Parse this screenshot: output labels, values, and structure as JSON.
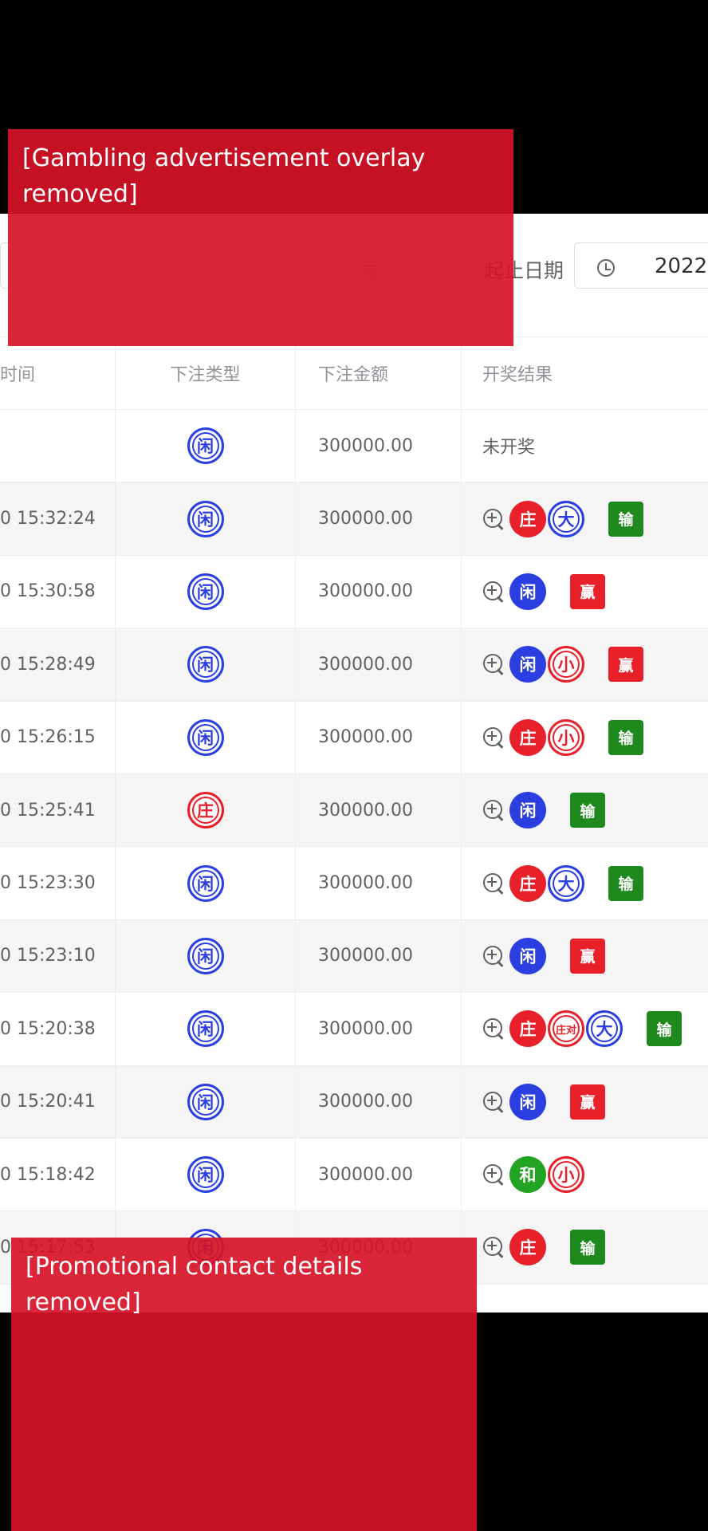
{
  "filter": {
    "search_placeholder": "号",
    "date_label": "起止日期",
    "date_value": "2022-"
  },
  "table": {
    "headers": {
      "time": "时间",
      "type": "下注类型",
      "amount": "下注金额",
      "result": "开奖结果"
    },
    "rows": [
      {
        "time": "",
        "type": "闲",
        "type_color": "blue",
        "amount": "300000.00",
        "result_text": "未开奖",
        "chips": [],
        "outcome": null
      },
      {
        "time": "0 15:32:24",
        "type": "闲",
        "type_color": "blue",
        "amount": "300000.00",
        "chips": [
          {
            "label": "庄",
            "style": "solid-red"
          },
          {
            "label": "大",
            "style": "outline-blue"
          }
        ],
        "outcome": {
          "label": "输",
          "kind": "lose"
        }
      },
      {
        "time": "0 15:30:58",
        "type": "闲",
        "type_color": "blue",
        "amount": "300000.00",
        "chips": [
          {
            "label": "闲",
            "style": "solid-blue"
          }
        ],
        "outcome": {
          "label": "赢",
          "kind": "win"
        }
      },
      {
        "time": "0 15:28:49",
        "type": "闲",
        "type_color": "blue",
        "amount": "300000.00",
        "chips": [
          {
            "label": "闲",
            "style": "solid-blue"
          },
          {
            "label": "小",
            "style": "outline-red"
          }
        ],
        "outcome": {
          "label": "赢",
          "kind": "win"
        }
      },
      {
        "time": "0 15:26:15",
        "type": "闲",
        "type_color": "blue",
        "amount": "300000.00",
        "chips": [
          {
            "label": "庄",
            "style": "solid-red"
          },
          {
            "label": "小",
            "style": "outline-red"
          }
        ],
        "outcome": {
          "label": "输",
          "kind": "lose"
        }
      },
      {
        "time": "0 15:25:41",
        "type": "庄",
        "type_color": "red",
        "amount": "300000.00",
        "chips": [
          {
            "label": "闲",
            "style": "solid-blue"
          }
        ],
        "outcome": {
          "label": "输",
          "kind": "lose"
        }
      },
      {
        "time": "0 15:23:30",
        "type": "闲",
        "type_color": "blue",
        "amount": "300000.00",
        "chips": [
          {
            "label": "庄",
            "style": "solid-red"
          },
          {
            "label": "大",
            "style": "outline-blue"
          }
        ],
        "outcome": {
          "label": "输",
          "kind": "lose"
        }
      },
      {
        "time": "0 15:23:10",
        "type": "闲",
        "type_color": "blue",
        "amount": "300000.00",
        "chips": [
          {
            "label": "闲",
            "style": "solid-blue"
          }
        ],
        "outcome": {
          "label": "赢",
          "kind": "win"
        }
      },
      {
        "time": "0 15:20:38",
        "type": "闲",
        "type_color": "blue",
        "amount": "300000.00",
        "chips": [
          {
            "label": "庄",
            "style": "solid-red"
          },
          {
            "label": "庄对",
            "style": "outline-red"
          },
          {
            "label": "大",
            "style": "outline-blue"
          }
        ],
        "outcome": {
          "label": "输",
          "kind": "lose"
        }
      },
      {
        "time": "0 15:20:41",
        "type": "闲",
        "type_color": "blue",
        "amount": "300000.00",
        "chips": [
          {
            "label": "闲",
            "style": "solid-blue"
          }
        ],
        "outcome": {
          "label": "赢",
          "kind": "win"
        }
      },
      {
        "time": "0 15:18:42",
        "type": "闲",
        "type_color": "blue",
        "amount": "300000.00",
        "chips": [
          {
            "label": "和",
            "style": "solid-green"
          },
          {
            "label": "小",
            "style": "outline-red"
          }
        ],
        "outcome": null
      },
      {
        "time": "0 15:17:53",
        "type": "闲",
        "type_color": "blue",
        "amount": "300000.00",
        "chips": [
          {
            "label": "庄",
            "style": "solid-red"
          }
        ],
        "outcome": {
          "label": "输",
          "kind": "lose"
        }
      },
      {
        "time": "",
        "type": "",
        "type_color": "blue",
        "amount": "",
        "chips": [],
        "outcome": null
      }
    ]
  },
  "notices": {
    "top": "[Gambling advertisement overlay removed]",
    "bottom": "[Promotional contact details removed]"
  },
  "colors": {
    "blue": "#2b3fe0",
    "red": "#e8202a",
    "green": "#22a322",
    "lose_tag": "#1e8a1e",
    "win_tag": "#e8202a",
    "overlay": "#d61226"
  }
}
